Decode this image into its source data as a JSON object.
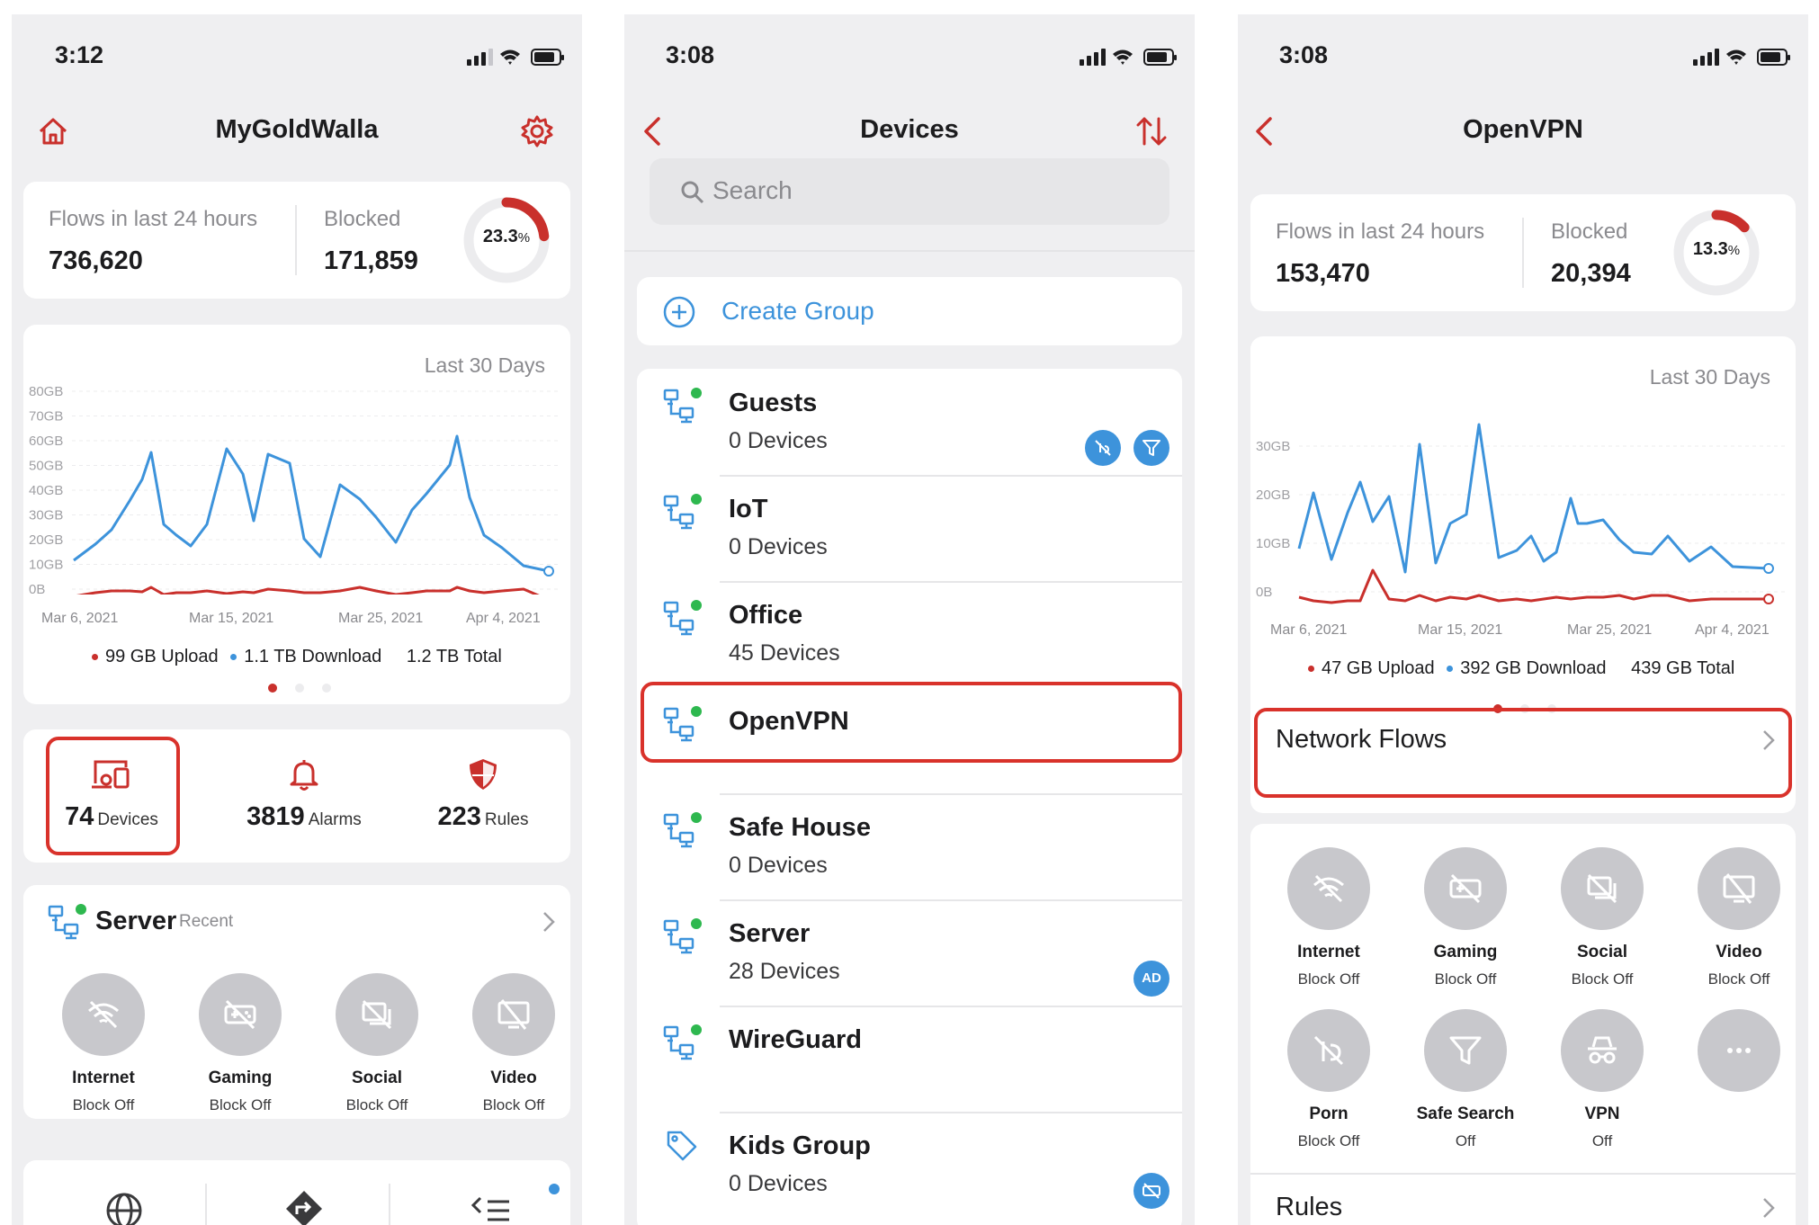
{
  "colors": {
    "accent": "#c9302c",
    "blue": "#3d93db",
    "green": "#2eb84f",
    "grey_button": "#c8c8cc"
  },
  "screen1": {
    "time": "3:12",
    "title": "MyGoldWalla",
    "flows": {
      "label": "Flows in last 24 hours",
      "value": "736,620"
    },
    "blocked": {
      "label": "Blocked",
      "value": "171,859"
    },
    "blocked_pct": "23.3",
    "pct_sign": "%",
    "chart": {
      "title": "Last 30 Days",
      "y_ticks": [
        "80GB",
        "70GB",
        "60GB",
        "50GB",
        "40GB",
        "30GB",
        "20GB",
        "10GB",
        "0B"
      ],
      "x_ticks": [
        "Mar 6, 2021",
        "Mar 15, 2021",
        "Mar 25, 2021",
        "Apr 4, 2021"
      ],
      "legend_upload": "99 GB Upload",
      "legend_download": "1.1 TB Download",
      "legend_total": "1.2 TB Total"
    },
    "stats": {
      "devices_num": "74",
      "devices_lbl": "Devices",
      "alarms_num": "3819",
      "alarms_lbl": "Alarms",
      "rules_num": "223",
      "rules_lbl": "Rules"
    },
    "server": {
      "name": "Server",
      "tag": "Recent"
    },
    "controls": [
      {
        "name": "Internet",
        "state": "Block Off",
        "icon": "wifi-off-icon"
      },
      {
        "name": "Gaming",
        "state": "Block Off",
        "icon": "gamepad-off-icon"
      },
      {
        "name": "Social",
        "state": "Block Off",
        "icon": "social-off-icon"
      },
      {
        "name": "Video",
        "state": "Block Off",
        "icon": "video-off-icon"
      }
    ]
  },
  "screen2": {
    "time": "3:08",
    "title": "Devices",
    "search_placeholder": "Search",
    "create_group": "Create Group",
    "groups": [
      {
        "name": "Guests",
        "sub": "0 Devices"
      },
      {
        "name": "IoT",
        "sub": "0 Devices"
      },
      {
        "name": "Office",
        "sub": "45 Devices"
      },
      {
        "name": "OpenVPN",
        "sub": ""
      },
      {
        "name": "Safe House",
        "sub": "0 Devices"
      },
      {
        "name": "Server",
        "sub": "28 Devices"
      },
      {
        "name": "WireGuard",
        "sub": ""
      },
      {
        "name": "Kids Group",
        "sub": "0 Devices"
      }
    ],
    "badge_ad": "AD"
  },
  "screen3": {
    "time": "3:08",
    "title": "OpenVPN",
    "flows": {
      "label": "Flows in last 24 hours",
      "value": "153,470"
    },
    "blocked": {
      "label": "Blocked",
      "value": "20,394"
    },
    "blocked_pct": "13.3",
    "pct_sign": "%",
    "chart": {
      "title": "Last 30 Days",
      "y_ticks": [
        "30GB",
        "20GB",
        "10GB",
        "0B"
      ],
      "x_ticks": [
        "Mar 6, 2021",
        "Mar 15, 2021",
        "Mar 25, 2021",
        "Apr 4, 2021"
      ],
      "legend_upload": "47 GB Upload",
      "legend_download": "392 GB Download",
      "legend_total": "439 GB Total"
    },
    "network_flows": "Network Flows",
    "controls": [
      {
        "name": "Internet",
        "state": "Block Off"
      },
      {
        "name": "Gaming",
        "state": "Block Off"
      },
      {
        "name": "Social",
        "state": "Block Off"
      },
      {
        "name": "Video",
        "state": "Block Off"
      },
      {
        "name": "Porn",
        "state": "Block Off"
      },
      {
        "name": "Safe Search",
        "state": "Off"
      },
      {
        "name": "VPN",
        "state": "Off"
      }
    ],
    "rules": "Rules"
  }
}
